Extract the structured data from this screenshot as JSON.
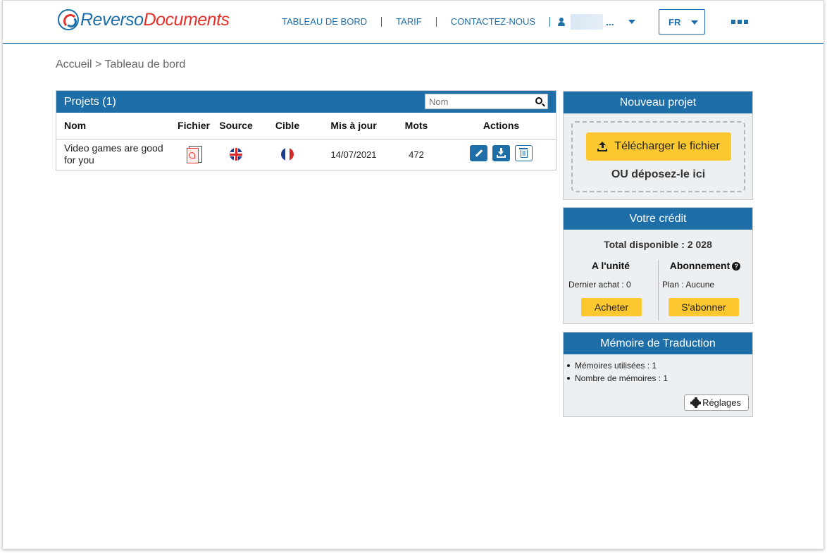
{
  "header": {
    "logo_part1": "Reverso",
    "logo_part2": "Documents",
    "nav": [
      "TABLEAU DE BORD",
      "TARIF",
      "CONTACTEZ-NOUS"
    ],
    "user_name_suffix": "...",
    "language": "FR"
  },
  "breadcrumb": "Accueil > Tableau de bord",
  "projects": {
    "title": "Projets (1)",
    "search_placeholder": "Nom",
    "columns": [
      "Nom",
      "Fichier",
      "Source",
      "Cible",
      "Mis à jour",
      "Mots",
      "Actions"
    ],
    "rows": [
      {
        "name": "Video games are good for you",
        "file_icon": "pdf-file-icon",
        "source_flag": "uk-flag-icon",
        "target_flag": "france-flag-icon",
        "updated": "14/07/2021",
        "words": "472"
      }
    ]
  },
  "new_project": {
    "title": "Nouveau projet",
    "upload_label": "Télécharger le fichier",
    "drop_label": "OU déposez-le ici"
  },
  "credit": {
    "title": "Votre crédit",
    "total": "Total disponible : 2 028",
    "unit_title": "A l'unité",
    "unit_info": "Dernier achat : 0",
    "buy_label": "Acheter",
    "sub_title": "Abonnement",
    "sub_info": "Plan : Aucune",
    "subscribe_label": "S'abonner"
  },
  "memory": {
    "title": "Mémoire de Traduction",
    "items": [
      "Mémoires utilisées : 1",
      "Nombre de mémoires : 1"
    ],
    "settings_label": "Réglages"
  },
  "colors": {
    "primary": "#1e6ea8",
    "accent_red": "#e4322b",
    "button_yellow": "#fdc82f",
    "panel_bg": "#edf0f3"
  }
}
